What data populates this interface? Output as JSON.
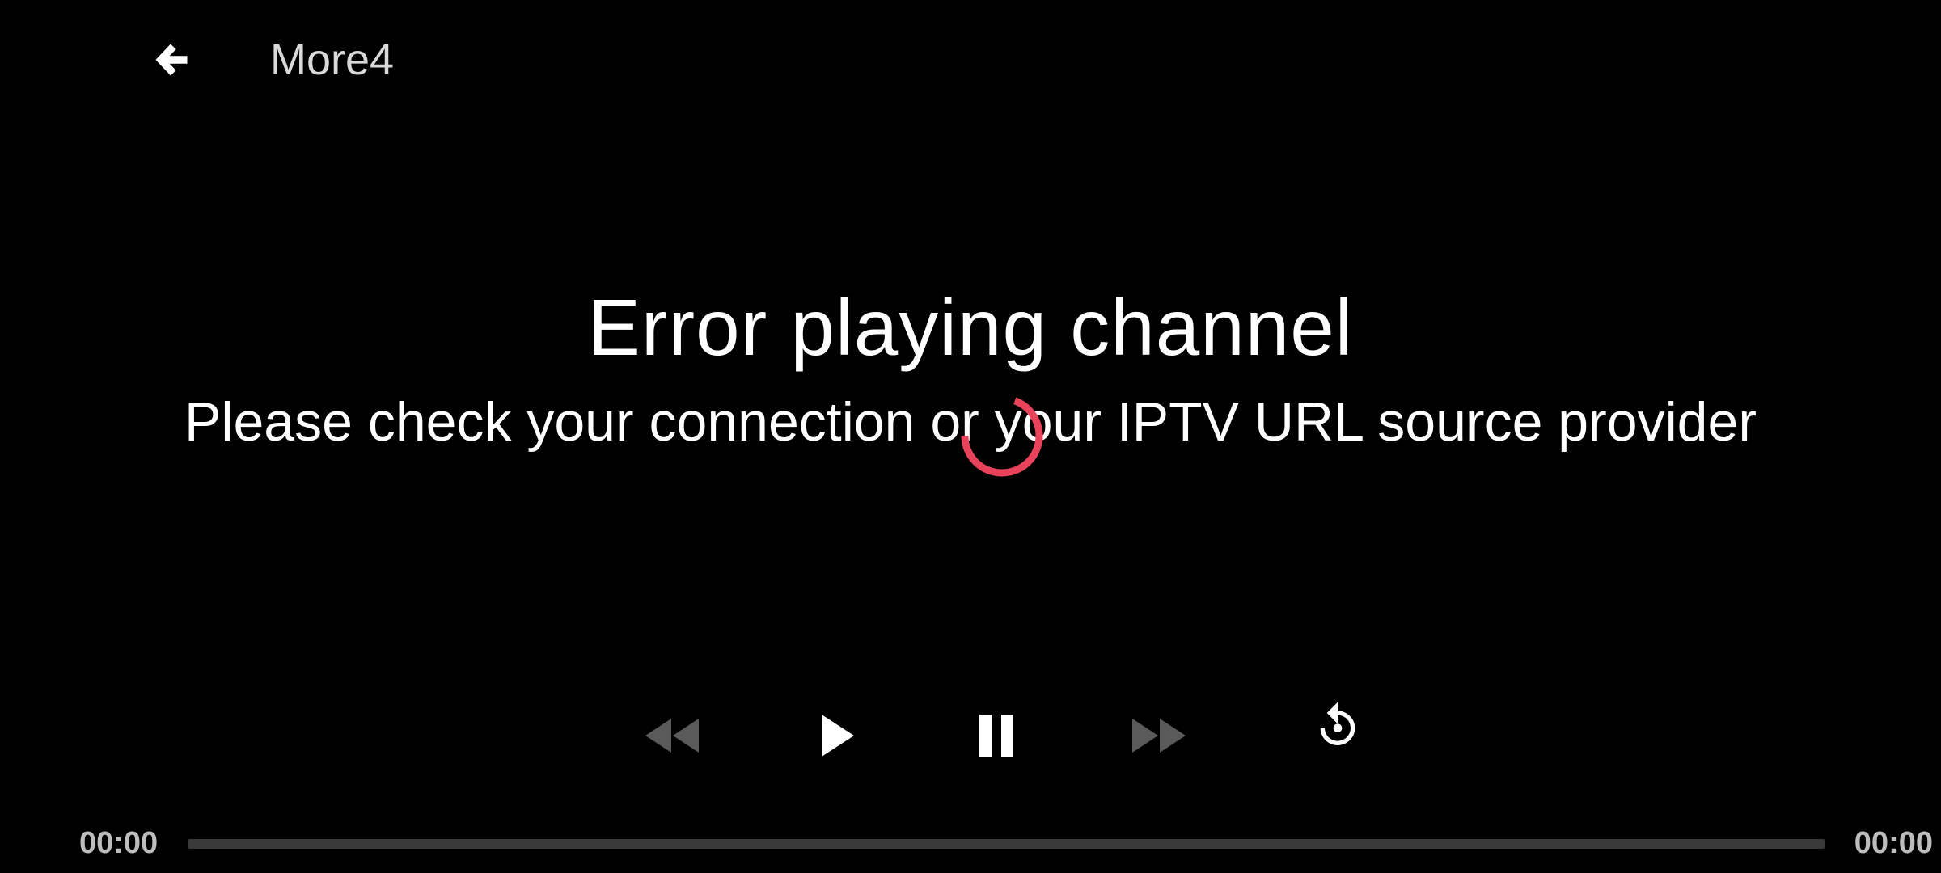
{
  "header": {
    "back_icon": "arrow-left-icon",
    "title": "More4"
  },
  "error": {
    "title": "Error playing channel",
    "message": "Please check your connection or your IPTV URL source provider"
  },
  "loading": {
    "icon": "loading-spinner",
    "color": "#e8435a"
  },
  "controls": {
    "buttons": [
      {
        "name": "rewind",
        "icon": "rewind-icon",
        "enabled": false
      },
      {
        "name": "play",
        "icon": "play-icon",
        "enabled": true
      },
      {
        "name": "pause",
        "icon": "pause-icon",
        "enabled": true
      },
      {
        "name": "fast-forward",
        "icon": "fast-forward-icon",
        "enabled": false
      },
      {
        "name": "replay",
        "icon": "replay-icon",
        "enabled": true
      }
    ]
  },
  "playback": {
    "position": "00:00",
    "duration": "00:00",
    "progress": 0
  },
  "colors": {
    "background": "#000000",
    "text": "#ffffff",
    "disabled_icon": "#5a5a5a",
    "seek_track": "#3a3a3a",
    "accent": "#e8435a"
  }
}
